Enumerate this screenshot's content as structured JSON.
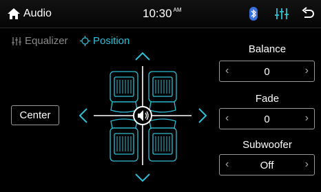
{
  "header": {
    "title": "Audio",
    "time": "10:30",
    "ampm": "AM",
    "icons": [
      "home-icon",
      "bluetooth-icon",
      "equalizer-icon",
      "back-icon"
    ]
  },
  "tabs": [
    {
      "label": "Equalizer",
      "active": false,
      "icon": "equalizer-icon"
    },
    {
      "label": "Position",
      "active": true,
      "icon": "position-icon"
    }
  ],
  "controls": {
    "balance": {
      "label": "Balance",
      "value": "0"
    },
    "fade": {
      "label": "Fade",
      "value": "0"
    },
    "subwoofer": {
      "label": "Subwoofer",
      "value": "Off"
    }
  },
  "center_button": "Center",
  "colors": {
    "accent": "#2fc0d4",
    "inactive": "#8a8a8a",
    "background": "#000000"
  }
}
